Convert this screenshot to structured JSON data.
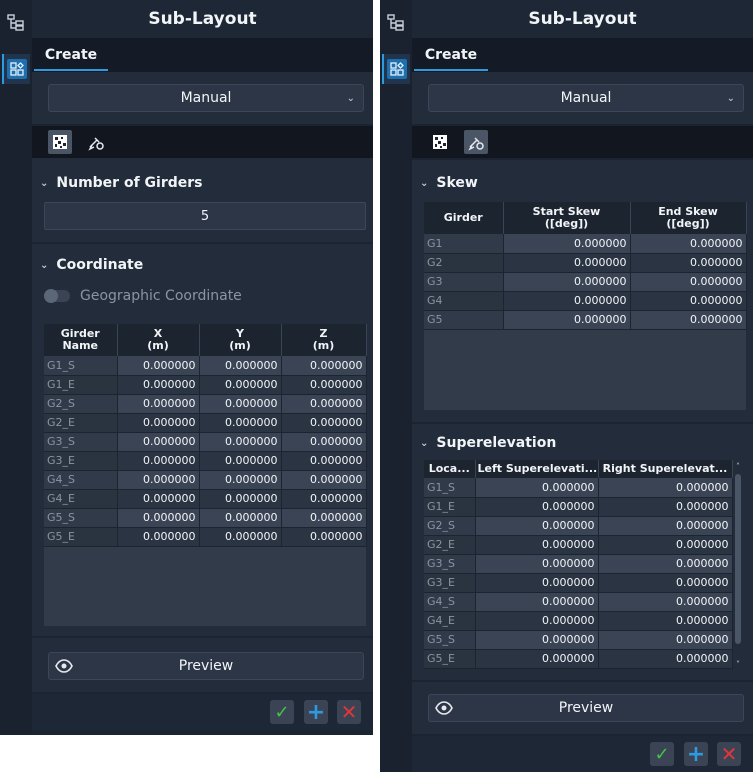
{
  "left": {
    "title": "Sub-Layout",
    "tab": "Create",
    "mode": "Manual",
    "girders_section": {
      "label": "Number of Girders",
      "value": "5"
    },
    "coord_section": {
      "label": "Coordinate",
      "toggle_label": "Geographic Coordinate",
      "headers": [
        "Girder\nName",
        "X\n(m)",
        "Y\n(m)",
        "Z\n(m)"
      ],
      "rows": [
        [
          "G1_S",
          "0.000000",
          "0.000000",
          "0.000000"
        ],
        [
          "G1_E",
          "0.000000",
          "0.000000",
          "0.000000"
        ],
        [
          "G2_S",
          "0.000000",
          "0.000000",
          "0.000000"
        ],
        [
          "G2_E",
          "0.000000",
          "0.000000",
          "0.000000"
        ],
        [
          "G3_S",
          "0.000000",
          "0.000000",
          "0.000000"
        ],
        [
          "G3_E",
          "0.000000",
          "0.000000",
          "0.000000"
        ],
        [
          "G4_S",
          "0.000000",
          "0.000000",
          "0.000000"
        ],
        [
          "G4_E",
          "0.000000",
          "0.000000",
          "0.000000"
        ],
        [
          "G5_S",
          "0.000000",
          "0.000000",
          "0.000000"
        ],
        [
          "G5_E",
          "0.000000",
          "0.000000",
          "0.000000"
        ]
      ]
    },
    "preview_label": "Preview"
  },
  "right": {
    "title": "Sub-Layout",
    "tab": "Create",
    "mode": "Manual",
    "skew_section": {
      "label": "Skew",
      "headers": [
        "Girder",
        "Start Skew\n([deg])",
        "End Skew\n([deg])"
      ],
      "rows": [
        [
          "G1",
          "0.000000",
          "0.000000"
        ],
        [
          "G2",
          "0.000000",
          "0.000000"
        ],
        [
          "G3",
          "0.000000",
          "0.000000"
        ],
        [
          "G4",
          "0.000000",
          "0.000000"
        ],
        [
          "G5",
          "0.000000",
          "0.000000"
        ]
      ]
    },
    "super_section": {
      "label": "Superelevation",
      "headers": [
        "Loca...",
        "Left Superelevati...",
        "Right Superelevat..."
      ],
      "rows": [
        [
          "G1_S",
          "0.000000",
          "0.000000"
        ],
        [
          "G1_E",
          "0.000000",
          "0.000000"
        ],
        [
          "G2_S",
          "0.000000",
          "0.000000"
        ],
        [
          "G2_E",
          "0.000000",
          "0.000000"
        ],
        [
          "G3_S",
          "0.000000",
          "0.000000"
        ],
        [
          "G3_E",
          "0.000000",
          "0.000000"
        ],
        [
          "G4_S",
          "0.000000",
          "0.000000"
        ],
        [
          "G4_E",
          "0.000000",
          "0.000000"
        ],
        [
          "G5_S",
          "0.000000",
          "0.000000"
        ],
        [
          "G5_E",
          "0.000000",
          "0.000000"
        ]
      ]
    },
    "preview_label": "Preview"
  },
  "icons": {
    "tree": "tree-structure-icon",
    "layout": "layout-grid-icon",
    "pattern": "pattern-grid-icon",
    "edit": "edit-brush-icon",
    "eye": "eye-icon",
    "ok": "checkmark-icon",
    "add": "plus-icon",
    "cancel": "close-icon"
  },
  "colors": {
    "accent": "#2e9be0",
    "ok": "#46c24c",
    "cancel": "#e0363b",
    "panel_bg": "#1c2432"
  }
}
